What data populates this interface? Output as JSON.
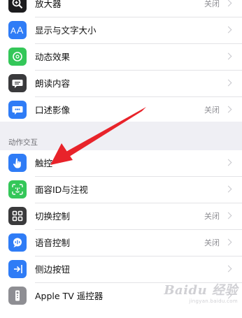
{
  "group1": {
    "rows": [
      {
        "label": "放大器",
        "value": "关闭",
        "icon": "magnifier-icon",
        "color": "#1c1c1e"
      },
      {
        "label": "显示与文字大小",
        "value": "",
        "icon": "text-size-icon",
        "color": "#2f7cf6"
      },
      {
        "label": "动态效果",
        "value": "",
        "icon": "motion-icon",
        "color": "#34c759"
      },
      {
        "label": "朗读内容",
        "value": "",
        "icon": "speech-bubble-icon",
        "color": "#3a3a3c"
      },
      {
        "label": "口述影像",
        "value": "关闭",
        "icon": "audio-description-icon",
        "color": "#2f7cf6"
      }
    ]
  },
  "section2": {
    "header": "动作交互",
    "rows": [
      {
        "label": "触控",
        "value": "",
        "icon": "hand-touch-icon",
        "color": "#2f7cf6"
      },
      {
        "label": "面容ID与注视",
        "value": "",
        "icon": "face-id-icon",
        "color": "#34c759"
      },
      {
        "label": "切换控制",
        "value": "关闭",
        "icon": "switch-control-icon",
        "color": "#3a3a3c"
      },
      {
        "label": "语音控制",
        "value": "关闭",
        "icon": "voice-control-icon",
        "color": "#2f7cf6"
      },
      {
        "label": "侧边按钮",
        "value": "",
        "icon": "side-button-icon",
        "color": "#2f7cf6"
      },
      {
        "label": "Apple TV 遥控器",
        "value": "",
        "icon": "tv-remote-icon",
        "color": "#8e8e93"
      }
    ]
  },
  "annotation": {
    "arrow_color": "#e8232a"
  },
  "watermark": {
    "main": "Baidu 经验",
    "sub": "jingyan.baidu.com"
  }
}
